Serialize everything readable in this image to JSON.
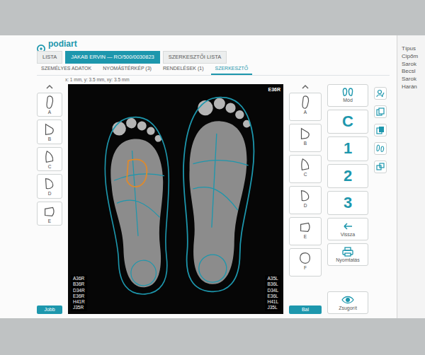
{
  "app": {
    "logo": "podiart"
  },
  "tabs": [
    {
      "label": "LISTA",
      "selected": false
    },
    {
      "label": "JAKAB ERVIN — RO/500/0030823",
      "selected": true
    },
    {
      "label": "SZERKESZTŐI LISTA",
      "selected": false
    }
  ],
  "subtabs": [
    {
      "label": "SZEMÉLYES ADATOK",
      "selected": false
    },
    {
      "label": "NYOMÁSTÉRKÉP (3)",
      "selected": false
    },
    {
      "label": "RENDELÉSEK (1)",
      "selected": false
    },
    {
      "label": "SZERKESZTŐ",
      "selected": true
    }
  ],
  "measure": "x: 1 mm, y: 3.5 mm, xy: 3.5 mm",
  "scan": {
    "code": "E36R",
    "right_codes": [
      "A36R",
      "B36R",
      "D34R",
      "E36R",
      "H41R",
      "J35R"
    ],
    "left_codes": [
      "A35L",
      "B36L",
      "D34L",
      "E36L",
      "H41L",
      "J35L"
    ]
  },
  "right_foot": {
    "label": "Jobb",
    "shapes": [
      "A",
      "B",
      "C",
      "D",
      "E"
    ]
  },
  "left_foot": {
    "label": "Bal",
    "shapes": [
      "A",
      "B",
      "C",
      "D",
      "E",
      "F"
    ]
  },
  "tools": [
    {
      "label": "Mód",
      "kind": "icon"
    },
    {
      "label": "C",
      "kind": "big"
    },
    {
      "label": "1",
      "kind": "big"
    },
    {
      "label": "2",
      "kind": "big"
    },
    {
      "label": "3",
      "kind": "big"
    },
    {
      "label": "Vissza",
      "kind": "icon"
    },
    {
      "label": "Nyomtatás",
      "kind": "icon"
    },
    {
      "label": "Zsugorít",
      "kind": "icon"
    }
  ],
  "panel": [
    "Típus",
    "Cipőm",
    "Sarok",
    "Becsl",
    "Sarok",
    "Harán"
  ]
}
